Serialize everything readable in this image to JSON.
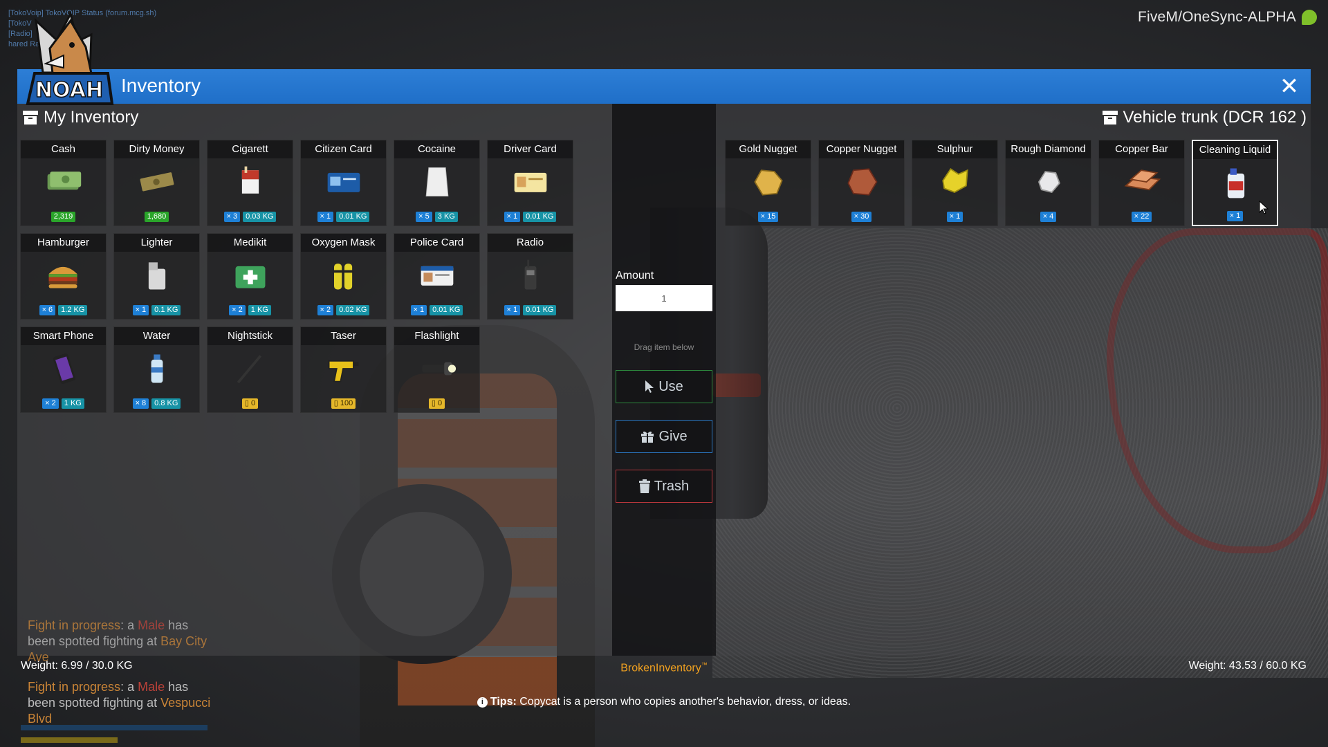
{
  "server": {
    "name": "FiveM/OneSync-ALPHA"
  },
  "radio": {
    "lines": [
      "[TokoVoip] TokoVOIP Status (forum.mcg.sh)",
      "[TokoV",
      "[Radio]",
      "hared Radio"
    ]
  },
  "logo": {
    "text": "NOAH"
  },
  "window": {
    "title": "Inventory"
  },
  "left_panel": {
    "title": "My Inventory",
    "weight": "Weight: 6.99 / 30.0 KG",
    "items": [
      {
        "name": "Cash",
        "icon": "cash-icon",
        "badges": [
          {
            "text": "2,319",
            "color": "green"
          }
        ]
      },
      {
        "name": "Dirty Money",
        "icon": "dirty-money-icon",
        "badges": [
          {
            "text": "1,680",
            "color": "green"
          }
        ]
      },
      {
        "name": "Cigarett",
        "icon": "cigarette-pack-icon",
        "badges": [
          {
            "text": "× 3",
            "color": "blue"
          },
          {
            "text": "0.03 KG",
            "color": "teal"
          }
        ]
      },
      {
        "name": "Citizen Card",
        "icon": "citizen-card-icon",
        "badges": [
          {
            "text": "× 1",
            "color": "blue"
          },
          {
            "text": "0.01 KG",
            "color": "teal"
          }
        ]
      },
      {
        "name": "Cocaine",
        "icon": "cocaine-bag-icon",
        "badges": [
          {
            "text": "× 5",
            "color": "blue"
          },
          {
            "text": "3 KG",
            "color": "teal"
          }
        ]
      },
      {
        "name": "Driver Card",
        "icon": "driver-card-icon",
        "badges": [
          {
            "text": "× 1",
            "color": "blue"
          },
          {
            "text": "0.01 KG",
            "color": "teal"
          }
        ]
      },
      {
        "name": "Hamburger",
        "icon": "hamburger-icon",
        "badges": [
          {
            "text": "× 6",
            "color": "blue"
          },
          {
            "text": "1.2 KG",
            "color": "teal"
          }
        ]
      },
      {
        "name": "Lighter",
        "icon": "lighter-icon",
        "badges": [
          {
            "text": "× 1",
            "color": "blue"
          },
          {
            "text": "0.1 KG",
            "color": "teal"
          }
        ]
      },
      {
        "name": "Medikit",
        "icon": "medikit-icon",
        "badges": [
          {
            "text": "× 2",
            "color": "blue"
          },
          {
            "text": "1 KG",
            "color": "teal"
          }
        ]
      },
      {
        "name": "Oxygen Mask",
        "icon": "oxygen-tanks-icon",
        "badges": [
          {
            "text": "× 2",
            "color": "blue"
          },
          {
            "text": "0.02 KG",
            "color": "teal"
          }
        ]
      },
      {
        "name": "Police Card",
        "icon": "police-card-icon",
        "badges": [
          {
            "text": "× 1",
            "color": "blue"
          },
          {
            "text": "0.01 KG",
            "color": "teal"
          }
        ]
      },
      {
        "name": "Radio",
        "icon": "radio-icon",
        "badges": [
          {
            "text": "× 1",
            "color": "blue"
          },
          {
            "text": "0.01 KG",
            "color": "teal"
          }
        ]
      },
      {
        "name": "Smart Phone",
        "icon": "smartphone-icon",
        "badges": [
          {
            "text": "× 2",
            "color": "blue"
          },
          {
            "text": "1 KG",
            "color": "teal"
          }
        ]
      },
      {
        "name": "Water",
        "icon": "water-bottle-icon",
        "badges": [
          {
            "text": "× 8",
            "color": "blue"
          },
          {
            "text": "0.8 KG",
            "color": "teal"
          }
        ]
      },
      {
        "name": "Nightstick",
        "icon": "nightstick-icon",
        "badges": [
          {
            "text": "▯ 0",
            "color": "yellow"
          }
        ]
      },
      {
        "name": "Taser",
        "icon": "taser-icon",
        "badges": [
          {
            "text": "▯ 100",
            "color": "yellow"
          }
        ]
      },
      {
        "name": "Flashlight",
        "icon": "flashlight-icon",
        "badges": [
          {
            "text": "▯ 0",
            "color": "yellow"
          }
        ]
      }
    ]
  },
  "right_panel": {
    "title": "Vehicle trunk (DCR 162 )",
    "weight": "Weight: 43.53 / 60.0 KG",
    "selected_index": 5,
    "items": [
      {
        "name": "Gold Nugget",
        "icon": "gold-nugget-icon",
        "badges": [
          {
            "text": "× 15",
            "color": "blue"
          }
        ]
      },
      {
        "name": "Copper Nugget",
        "icon": "copper-nugget-icon",
        "badges": [
          {
            "text": "× 30",
            "color": "blue"
          }
        ]
      },
      {
        "name": "Sulphur",
        "icon": "sulphur-icon",
        "badges": [
          {
            "text": "× 1",
            "color": "blue"
          }
        ]
      },
      {
        "name": "Rough Diamond",
        "icon": "rough-diamond-icon",
        "badges": [
          {
            "text": "× 4",
            "color": "blue"
          }
        ]
      },
      {
        "name": "Copper Bar",
        "icon": "copper-bar-icon",
        "badges": [
          {
            "text": "× 22",
            "color": "blue"
          }
        ]
      },
      {
        "name": "Cleaning Liquid",
        "icon": "cleaning-liquid-icon",
        "badges": [
          {
            "text": "× 1",
            "color": "blue"
          }
        ]
      }
    ]
  },
  "controls": {
    "amount_label": "Amount",
    "amount_value": "1",
    "drag_hint": "Drag item below",
    "use_label": "Use",
    "give_label": "Give",
    "trash_label": "Trash",
    "brand": "BrokenInventory",
    "brand_tm": "™"
  },
  "tips": {
    "prefix": "Tips:",
    "text": " Copycat is a person who copies another's behavior, dress, or ideas."
  },
  "notifications": [
    {
      "lead": "Fight in progress",
      "a": ": a ",
      "who": "Male",
      "mid": " has been spotted fighting at ",
      "where": "Bay City Ave"
    },
    {
      "lead": "Fight in progress",
      "a": ": a ",
      "who": "Male",
      "mid": " has been spotted fighting at ",
      "where": "Vespucci Blvd"
    }
  ],
  "colors": {
    "header": "#1f6fc8",
    "use": "#2d8a3e",
    "give": "#2b78c4",
    "trash": "#b5363b",
    "brand": "#f0a020",
    "count_badge": "#1e80d6",
    "weight_badge": "#1793a6",
    "money_badge": "#2aa52a",
    "ammo_badge": "#e5b72a"
  }
}
